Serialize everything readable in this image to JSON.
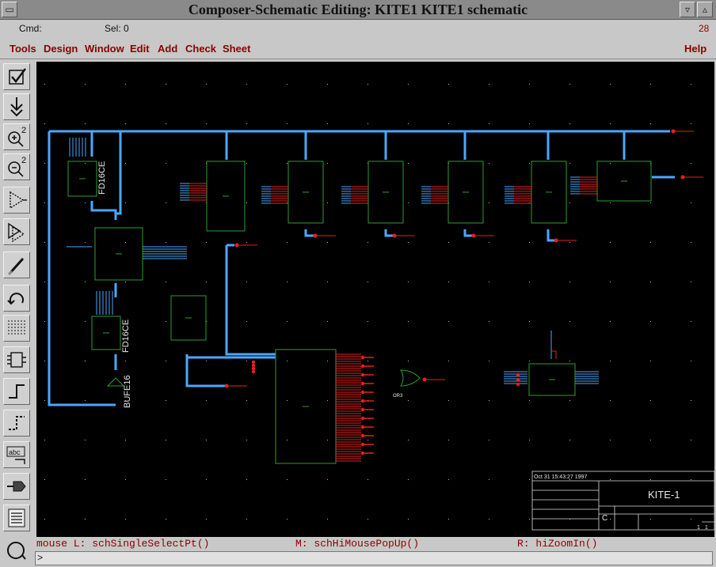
{
  "window": {
    "title": "Composer-Schematic Editing: KITE1 KITE1 schematic",
    "menu_glyph": "▭",
    "minimize_glyph": "▿",
    "maximize_glyph": "▵"
  },
  "status": {
    "cmd": "Cmd:",
    "sel": "Sel: 0",
    "count": "28"
  },
  "menu": {
    "tools": "Tools",
    "design": "Design",
    "window": "Window",
    "edit": "Edit",
    "add": "Add",
    "check": "Check",
    "sheet": "Sheet",
    "help": "Help"
  },
  "toolbar": {
    "zoom_in_label": "2",
    "zoom_out_label": "2",
    "label_tool_text": "abc"
  },
  "schematic": {
    "components": {
      "fd16ce_1": "FD16CE",
      "fd16ce_2": "FD16CE",
      "bufe16": "BUFE16",
      "or3": "OR3"
    },
    "title_block": {
      "date": "Oct 31 15:43:27 1997",
      "name": "KITE-1",
      "sheet_letter": "C",
      "sheet_num": "1",
      "rev": "1"
    }
  },
  "mouse_bindings": {
    "left": "mouse L: schSingleSelectPt()",
    "middle": "M: schHiMousePopUp()",
    "right": "R: hiZoomIn()"
  },
  "command_line": {
    "prompt": ">"
  },
  "colors": {
    "wire": "#4aa8ff",
    "component": "#2e9e2e",
    "pin": "#e8201c",
    "canvas": "#000000",
    "menu_text": "#8b0000"
  }
}
